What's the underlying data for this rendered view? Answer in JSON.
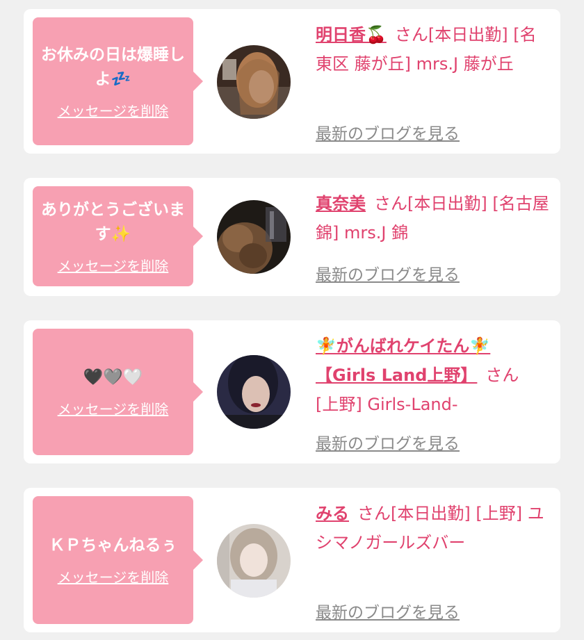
{
  "cards": [
    {
      "message": "お休みの日は爆睡しよ💤",
      "delete_label": "メッセージを削除",
      "name": "明日香🍒",
      "honorific": "さん",
      "details": "[本日出勤] [名東区 藤が丘] mrs.J 藤が丘",
      "blog_label": "最新のブログを見る"
    },
    {
      "message": "ありがとうございます✨",
      "delete_label": "メッセージを削除",
      "name": "真奈美",
      "honorific": "さん",
      "details": "[本日出勤] [名古屋 錦] mrs.J 錦",
      "blog_label": "最新のブログを見る"
    },
    {
      "message": "🖤🩶🤍",
      "delete_label": "メッセージを削除",
      "name": "🧚がんばれケイたん🧚 【Girls Land上野】",
      "honorific": "さん",
      "details": "[上野] Girls-Land-",
      "blog_label": "最新のブログを見る"
    },
    {
      "message": "ＫＰちゃんねるぅ",
      "delete_label": "メッセージを削除",
      "name": "みる",
      "honorific": "さん",
      "details": "[本日出勤] [上野] ユシマノガールズバー",
      "blog_label": "最新のブログを見る"
    }
  ]
}
